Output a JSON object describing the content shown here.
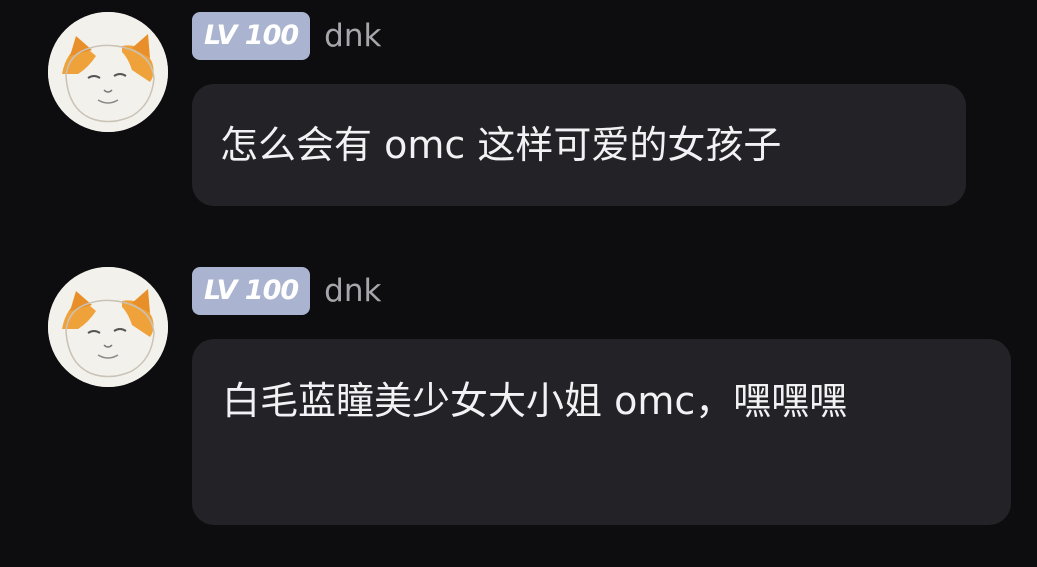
{
  "messages": [
    {
      "level_badge": "LV 100",
      "username": "dnk",
      "text": "怎么会有 omc 这样可爱的女孩子",
      "avatar_icon": "orange-white-cat-meme-avatar"
    },
    {
      "level_badge": "LV 100",
      "username": "dnk",
      "text": "白毛蓝瞳美少女大小姐 omc，嘿嘿嘿",
      "avatar_icon": "orange-white-cat-meme-avatar"
    }
  ],
  "colors": {
    "background": "#0d0d0f",
    "bubble": "#232327",
    "badge": "#aab3cf",
    "username": "#a6a6ac",
    "text": "#f2f2f4"
  }
}
